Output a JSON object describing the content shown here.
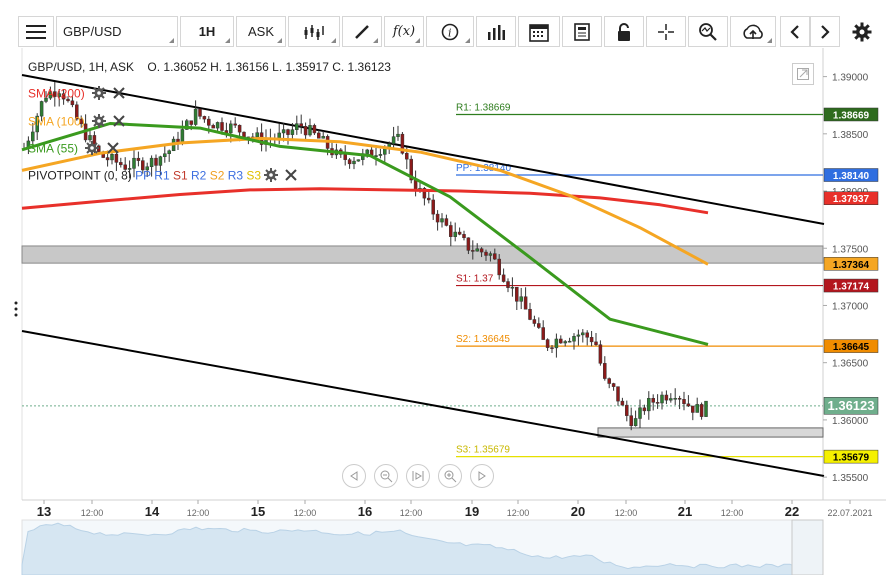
{
  "toolbar": {
    "symbol": "GBP/USD",
    "timeframe": "1H",
    "price_type": "ASK",
    "buttons": [
      "menu-icon",
      "candles-icon",
      "draw-icon",
      "function-icon",
      "info-icon",
      "volume-icon",
      "calendar-icon",
      "notes-icon",
      "lock-icon",
      "crosshair-icon",
      "zoom-icon",
      "cloud-upload-icon",
      "prev-icon",
      "next-icon",
      "settings-icon"
    ],
    "fx_label": "f(x)"
  },
  "header": {
    "instrument": "GBP/USD, 1H, ASK",
    "ohlc": "O. 1.36052 H. 1.36156 L. 1.35917 C. 1.36123"
  },
  "indicators": [
    {
      "label": "SMA (200)",
      "color": "#e8302a"
    },
    {
      "label": "SMA (100)",
      "color": "#f5a623"
    },
    {
      "label": "SMA (55)",
      "color": "#3a9a1e"
    }
  ],
  "pivot": {
    "label": "PIVOTPOINT (0, 8)",
    "items": [
      {
        "text": "PP",
        "color": "#3d6fe0"
      },
      {
        "text": "R1",
        "color": "#3d6fe0"
      },
      {
        "text": "S1",
        "color": "#c0392b"
      },
      {
        "text": "R2",
        "color": "#3d6fe0"
      },
      {
        "text": "S2",
        "color": "#f0a020"
      },
      {
        "text": "R3",
        "color": "#3d6fe0"
      },
      {
        "text": "S3",
        "color": "#e0c000"
      }
    ]
  },
  "levels": [
    {
      "name": "R1",
      "label": "R1: 1.38669",
      "value": 1.38669,
      "color": "#2e7d1e",
      "tag": "1.38669"
    },
    {
      "name": "PP",
      "label": "PP: 1.38140",
      "value": 1.3814,
      "color": "#2f6ee0",
      "tag": "1.38140"
    },
    {
      "name": "S1",
      "label": "S1: 1.37",
      "value": 1.37174,
      "color": "#b3161e",
      "tag": "1.37174"
    },
    {
      "name": "S2",
      "label": "S2: 1.36645",
      "value": 1.36645,
      "color": "#f08c00",
      "tag": "1.36645"
    },
    {
      "name": "S3",
      "label": "S3: 1.35679",
      "value": 1.35679,
      "color": "#e6e000",
      "tag": "1.35679"
    }
  ],
  "sma_tags": [
    {
      "value": 1.37937,
      "tag": "1.37937",
      "color": "#e8302a"
    },
    {
      "value": 1.37364,
      "tag": "1.37364",
      "color": "#f5a623"
    }
  ],
  "current_price": {
    "value": 1.36123,
    "tag": "1.36123",
    "color": "#6fae8c"
  },
  "price_axis": [
    "1.39000",
    "1.38500",
    "1.38000",
    "1.37500",
    "1.37000",
    "1.36500",
    "1.36000",
    "1.35500"
  ],
  "time_axis": [
    "13",
    "12:00",
    "14",
    "12:00",
    "15",
    "12:00",
    "16",
    "12:00",
    "19",
    "12:00",
    "20",
    "12:00",
    "21",
    "12:00",
    "22",
    "22.07.2021"
  ],
  "chart_data": {
    "type": "candlestick",
    "title": "GBP/USD, 1H, ASK",
    "ylim": [
      1.353,
      1.3925
    ],
    "x_labels": [
      "13",
      "14",
      "15",
      "16",
      "19",
      "20",
      "21",
      "22"
    ],
    "series": [
      {
        "name": "SMA (200)",
        "values": [
          1.3785,
          1.3791,
          1.3797,
          1.3801,
          1.3802,
          1.3801,
          1.38,
          1.3798,
          1.3794,
          1.3788,
          1.3781
        ]
      },
      {
        "name": "SMA (100)",
        "values": [
          1.3818,
          1.3833,
          1.3842,
          1.3846,
          1.3843,
          1.3834,
          1.3818,
          1.3796,
          1.3768,
          1.3736
        ]
      },
      {
        "name": "SMA (55)",
        "values": [
          1.3836,
          1.3859,
          1.3855,
          1.3839,
          1.3831,
          1.3795,
          1.3742,
          1.3688,
          1.3666
        ]
      }
    ],
    "ohlc_current": {
      "open": 1.36052,
      "high": 1.36156,
      "low": 1.35917,
      "close": 1.36123
    }
  }
}
